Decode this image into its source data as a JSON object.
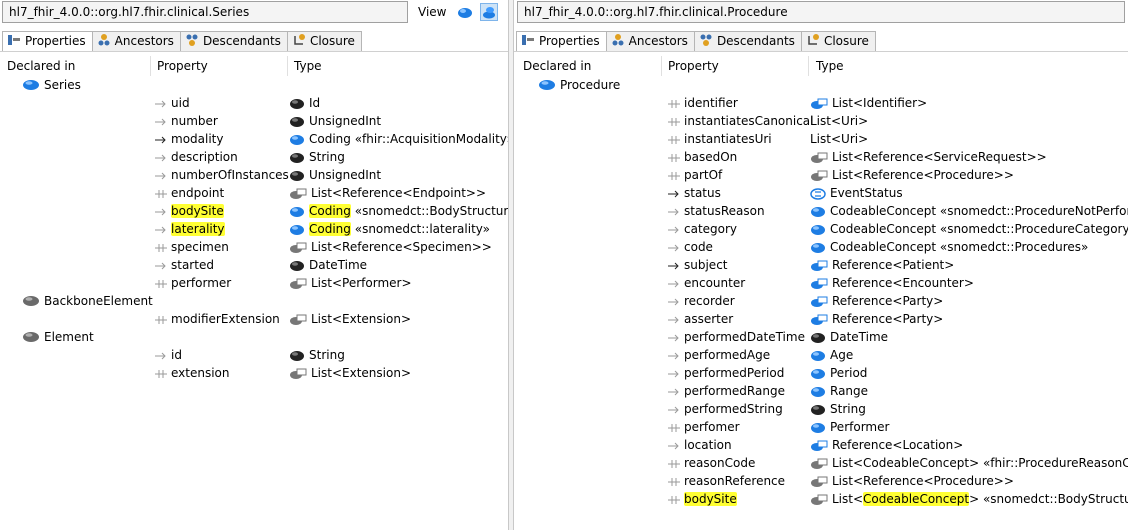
{
  "left": {
    "title": "hl7_fhir_4.0.0::org.hl7.fhir.clinical.Series",
    "view_label": "View",
    "tabs": [
      {
        "label": "Properties",
        "icon": "properties-icon",
        "active": true
      },
      {
        "label": "Ancestors",
        "icon": "ancestors-icon",
        "active": false
      },
      {
        "label": "Descendants",
        "icon": "descendants-icon",
        "active": false
      },
      {
        "label": "Closure",
        "icon": "closure-icon",
        "active": false
      }
    ],
    "headers": {
      "declared_in": "Declared in",
      "property": "Property",
      "type": "Type"
    },
    "rows": [
      {
        "kind": "class",
        "name": "Series",
        "icon": "blue-class-icon"
      },
      {
        "kind": "prop",
        "name": "uid",
        "prop_icon": "arrow",
        "type": "Id",
        "type_icon": "black",
        "hl": false
      },
      {
        "kind": "prop",
        "name": "number",
        "prop_icon": "arrow",
        "type": "UnsignedInt",
        "type_icon": "black",
        "hl": false
      },
      {
        "kind": "prop",
        "name": "modality",
        "prop_icon": "arrow-dark",
        "type": "Coding «fhir::AcquisitionModality»",
        "type_icon": "blue",
        "hl": false
      },
      {
        "kind": "prop",
        "name": "description",
        "prop_icon": "arrow",
        "type": "String",
        "type_icon": "black",
        "hl": false
      },
      {
        "kind": "prop",
        "name": "numberOfInstances",
        "prop_icon": "arrow",
        "type": "UnsignedInt",
        "type_icon": "black",
        "hl": false
      },
      {
        "kind": "prop",
        "name": "endpoint",
        "prop_icon": "list",
        "type": "List<Reference<Endpoint>>",
        "type_icon": "gray-list",
        "hl": false
      },
      {
        "kind": "prop",
        "name": "bodySite",
        "prop_icon": "arrow",
        "type_hl": "Coding",
        "type": " «snomedct::BodyStructures»",
        "type_icon": "blue",
        "hl": true
      },
      {
        "kind": "prop",
        "name": "laterality",
        "prop_icon": "arrow",
        "type_hl": "Coding",
        "type": " «snomedct::laterality»",
        "type_icon": "blue",
        "hl": true
      },
      {
        "kind": "prop",
        "name": "specimen",
        "prop_icon": "list",
        "type": "List<Reference<Specimen>>",
        "type_icon": "gray-list",
        "hl": false
      },
      {
        "kind": "prop",
        "name": "started",
        "prop_icon": "arrow",
        "type": "DateTime",
        "type_icon": "black",
        "hl": false
      },
      {
        "kind": "prop",
        "name": "performer",
        "prop_icon": "list",
        "type": "List<Performer>",
        "type_icon": "gray-list",
        "hl": false
      },
      {
        "kind": "class",
        "name": "BackboneElement",
        "icon": "gray-class-icon"
      },
      {
        "kind": "prop",
        "name": "modifierExtension",
        "prop_icon": "list",
        "type": "List<Extension>",
        "type_icon": "gray-list",
        "hl": false
      },
      {
        "kind": "class",
        "name": "Element",
        "icon": "gray-class-icon"
      },
      {
        "kind": "prop",
        "name": "id",
        "prop_icon": "arrow",
        "type": "String",
        "type_icon": "black",
        "hl": false
      },
      {
        "kind": "prop",
        "name": "extension",
        "prop_icon": "list",
        "type": "List<Extension>",
        "type_icon": "gray-list",
        "hl": false
      }
    ]
  },
  "right": {
    "title": "hl7_fhir_4.0.0::org.hl7.fhir.clinical.Procedure",
    "tabs": [
      {
        "label": "Properties",
        "icon": "properties-icon",
        "active": true
      },
      {
        "label": "Ancestors",
        "icon": "ancestors-icon",
        "active": false
      },
      {
        "label": "Descendants",
        "icon": "descendants-icon",
        "active": false
      },
      {
        "label": "Closure",
        "icon": "closure-icon",
        "active": false
      }
    ],
    "headers": {
      "declared_in": "Declared in",
      "property": "Property",
      "type": "Type"
    },
    "rows": [
      {
        "kind": "class",
        "name": "Procedure",
        "icon": "blue-class-icon"
      },
      {
        "kind": "prop",
        "name": "identifier",
        "prop_icon": "list",
        "type": "List<Identifier>",
        "type_icon": "blue-list",
        "hl": false
      },
      {
        "kind": "prop",
        "name": "instantiatesCanonical",
        "prop_icon": "list",
        "type": "List<Uri>",
        "type_icon": "none",
        "hl": false
      },
      {
        "kind": "prop",
        "name": "instantiatesUri",
        "prop_icon": "list",
        "type": "List<Uri>",
        "type_icon": "none",
        "hl": false
      },
      {
        "kind": "prop",
        "name": "basedOn",
        "prop_icon": "list",
        "type": "List<Reference<ServiceRequest>>",
        "type_icon": "gray-list",
        "hl": false
      },
      {
        "kind": "prop",
        "name": "partOf",
        "prop_icon": "list",
        "type": "List<Reference<Procedure>>",
        "type_icon": "gray-list",
        "hl": false
      },
      {
        "kind": "prop",
        "name": "status",
        "prop_icon": "arrow-dark",
        "type": "EventStatus",
        "type_icon": "enum",
        "hl": false
      },
      {
        "kind": "prop",
        "name": "statusReason",
        "prop_icon": "arrow",
        "type": "CodeableConcept «snomedct::ProcedureNotPerformed»",
        "type_icon": "blue",
        "hl": false
      },
      {
        "kind": "prop",
        "name": "category",
        "prop_icon": "arrow",
        "type": "CodeableConcept «snomedct::ProcedureCategory»",
        "type_icon": "blue",
        "hl": false
      },
      {
        "kind": "prop",
        "name": "code",
        "prop_icon": "arrow",
        "type": "CodeableConcept «snomedct::Procedures»",
        "type_icon": "blue",
        "hl": false
      },
      {
        "kind": "prop",
        "name": "subject",
        "prop_icon": "arrow-dark",
        "type": "Reference<Patient>",
        "type_icon": "blue-list",
        "hl": false
      },
      {
        "kind": "prop",
        "name": "encounter",
        "prop_icon": "arrow",
        "type": "Reference<Encounter>",
        "type_icon": "blue-list",
        "hl": false
      },
      {
        "kind": "prop",
        "name": "recorder",
        "prop_icon": "arrow",
        "type": "Reference<Party>",
        "type_icon": "blue-list",
        "hl": false
      },
      {
        "kind": "prop",
        "name": "asserter",
        "prop_icon": "arrow",
        "type": "Reference<Party>",
        "type_icon": "blue-list",
        "hl": false
      },
      {
        "kind": "prop",
        "name": "performedDateTime",
        "prop_icon": "arrow",
        "type": "DateTime",
        "type_icon": "black",
        "hl": false
      },
      {
        "kind": "prop",
        "name": "performedAge",
        "prop_icon": "arrow",
        "type": "Age",
        "type_icon": "blue",
        "hl": false
      },
      {
        "kind": "prop",
        "name": "performedPeriod",
        "prop_icon": "arrow",
        "type": "Period",
        "type_icon": "blue",
        "hl": false
      },
      {
        "kind": "prop",
        "name": "performedRange",
        "prop_icon": "arrow",
        "type": "Range",
        "type_icon": "blue",
        "hl": false
      },
      {
        "kind": "prop",
        "name": "performedString",
        "prop_icon": "arrow",
        "type": "String",
        "type_icon": "black",
        "hl": false
      },
      {
        "kind": "prop",
        "name": "perfomer",
        "prop_icon": "list",
        "type": "Performer",
        "type_icon": "blue",
        "hl": false
      },
      {
        "kind": "prop",
        "name": "location",
        "prop_icon": "arrow",
        "type": "Reference<Location>",
        "type_icon": "blue-list",
        "hl": false
      },
      {
        "kind": "prop",
        "name": "reasonCode",
        "prop_icon": "list",
        "type": "List<CodeableConcept> «fhir::ProcedureReasonCodes»",
        "type_icon": "gray-list",
        "hl": false
      },
      {
        "kind": "prop",
        "name": "reasonReference",
        "prop_icon": "list",
        "type": "List<Reference<Procedure>>",
        "type_icon": "gray-list",
        "hl": false
      },
      {
        "kind": "prop",
        "name": "bodySite",
        "prop_icon": "list",
        "type_pre": "List<",
        "type_hl": "CodeableConcept",
        "type": "> «snomedct::BodyStructures»",
        "type_icon": "gray-list",
        "hl": true
      }
    ]
  }
}
